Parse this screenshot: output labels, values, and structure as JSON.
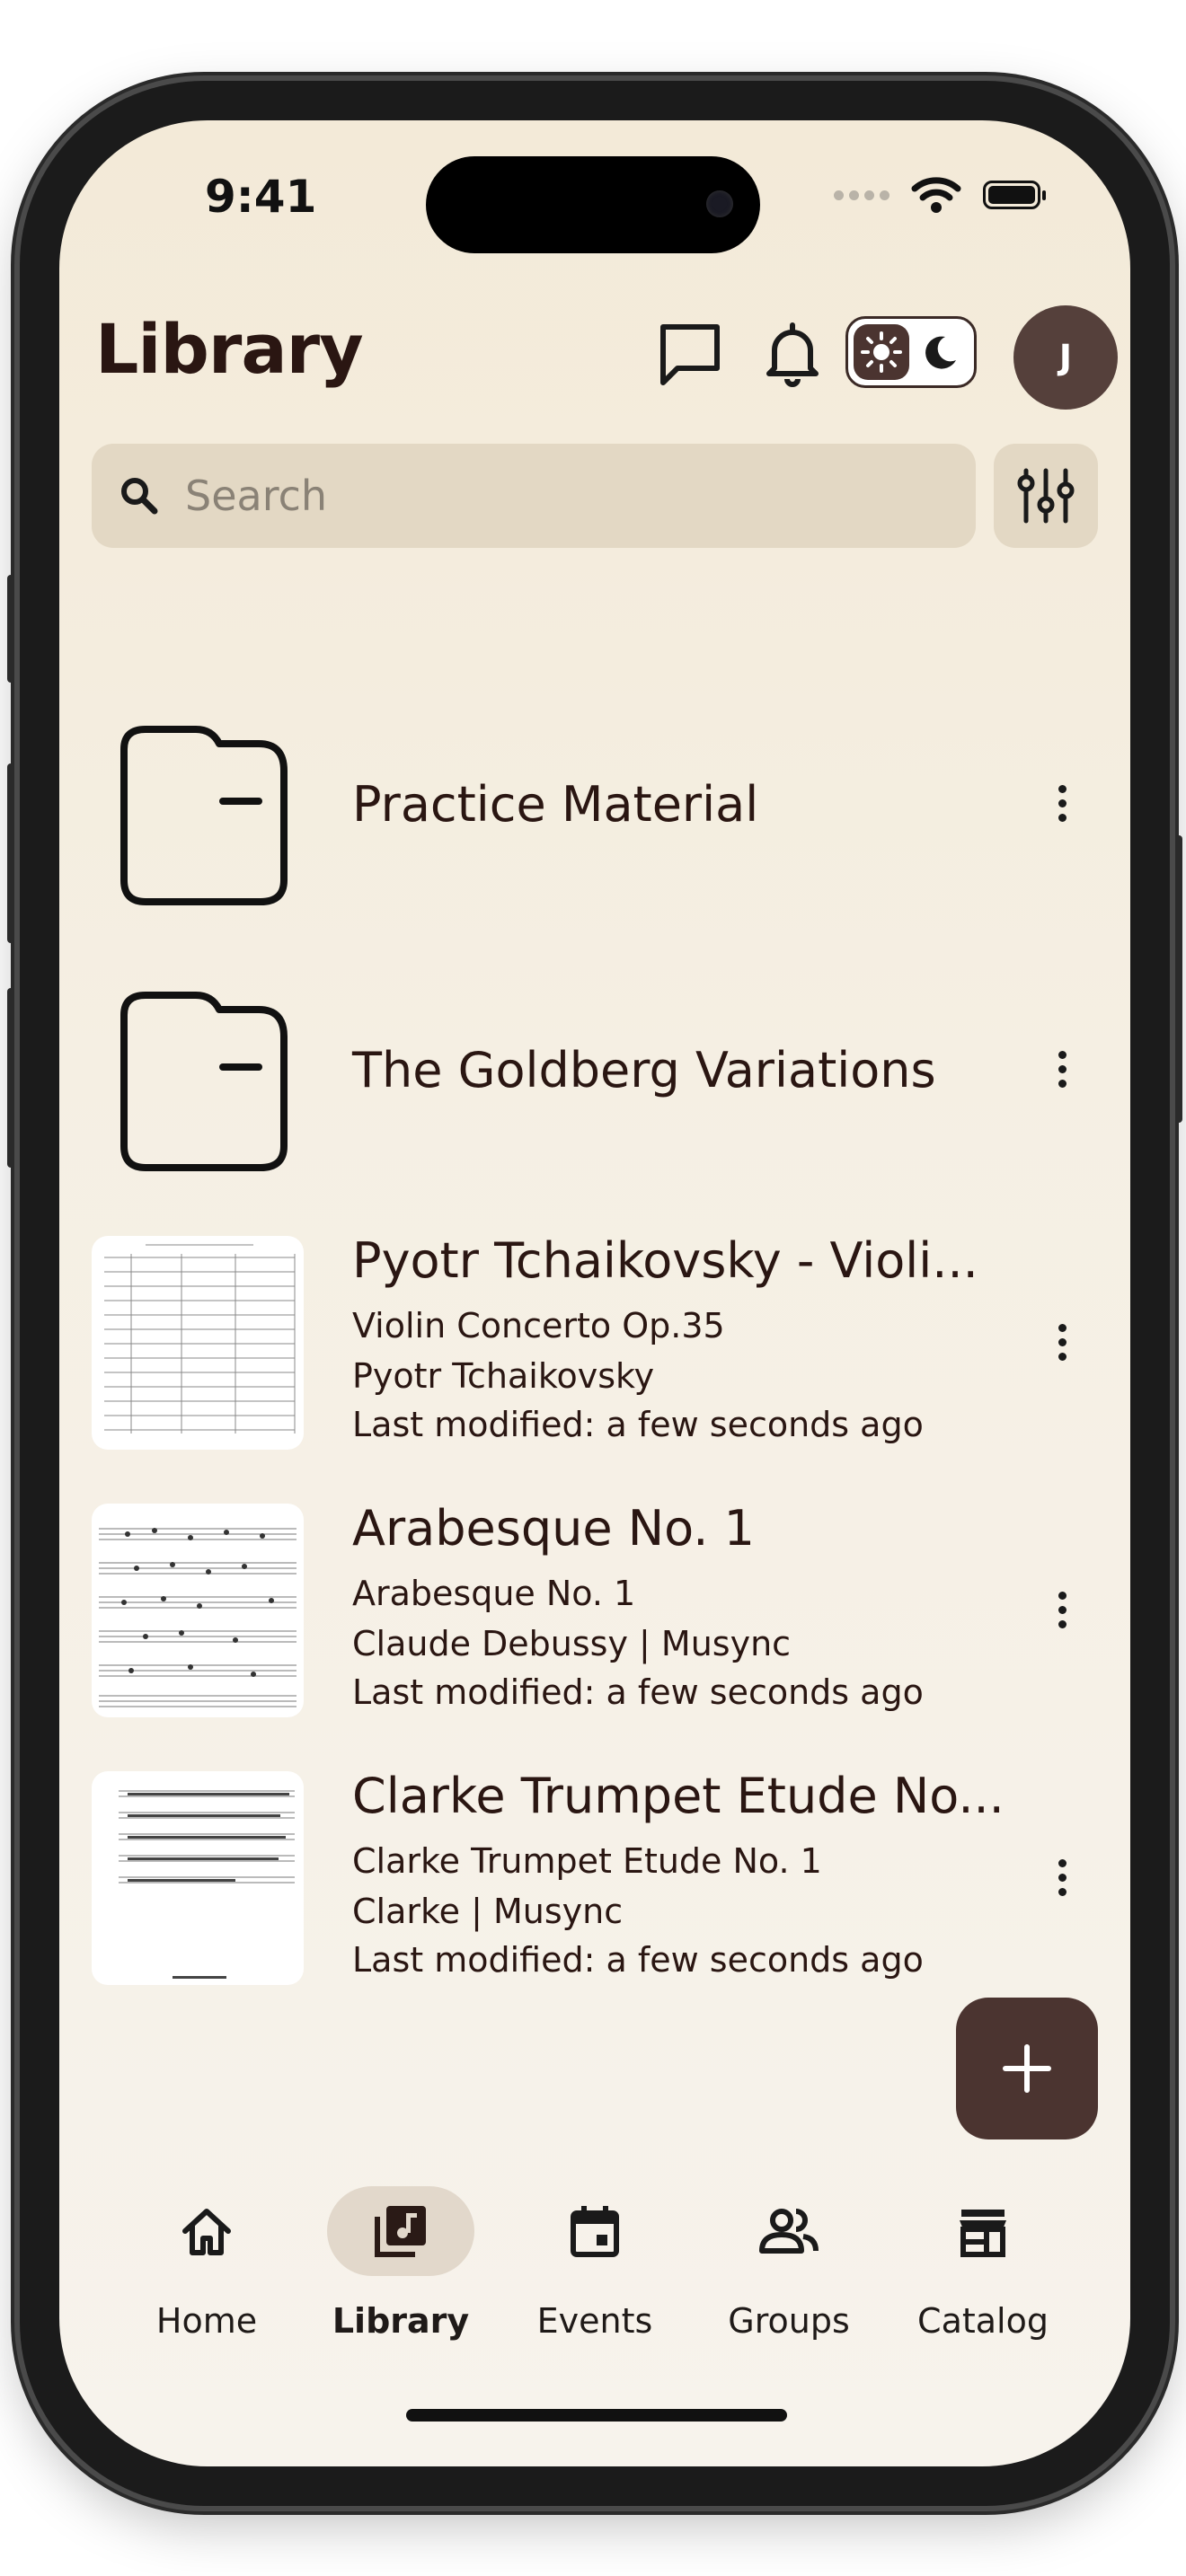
{
  "status_bar": {
    "time": "9:41"
  },
  "header": {
    "title": "Library",
    "avatar_initial": "J"
  },
  "search": {
    "placeholder": "Search",
    "value": ""
  },
  "folders": [
    {
      "name": "Practice Material"
    },
    {
      "name": "The Goldberg Variations"
    }
  ],
  "scores": [
    {
      "title": "Pyotr Tchaikovsky - Violi...",
      "subtitle": "Violin Concerto Op.35",
      "composer": "Pyotr Tchaikovsky",
      "modified": "Last modified: a few seconds ago"
    },
    {
      "title": "Arabesque No. 1",
      "subtitle": "Arabesque No. 1",
      "composer": "Claude Debussy | Musync",
      "modified": "Last modified: a few seconds ago"
    },
    {
      "title": "Clarke Trumpet Etude No...",
      "subtitle": "Clarke Trumpet Etude No. 1",
      "composer": "Clarke | Musync",
      "modified": "Last modified: a few seconds ago"
    }
  ],
  "nav": {
    "items": [
      {
        "label": "Home",
        "icon": "home-icon"
      },
      {
        "label": "Library",
        "icon": "library-music-icon"
      },
      {
        "label": "Events",
        "icon": "calendar-icon"
      },
      {
        "label": "Groups",
        "icon": "groups-icon"
      },
      {
        "label": "Catalog",
        "icon": "storefront-icon"
      }
    ],
    "active": "Library"
  },
  "colors": {
    "brand": "#4b3430",
    "text": "#2a1612",
    "search_bg": "#e3d8c4",
    "background": "#f3ead8"
  }
}
